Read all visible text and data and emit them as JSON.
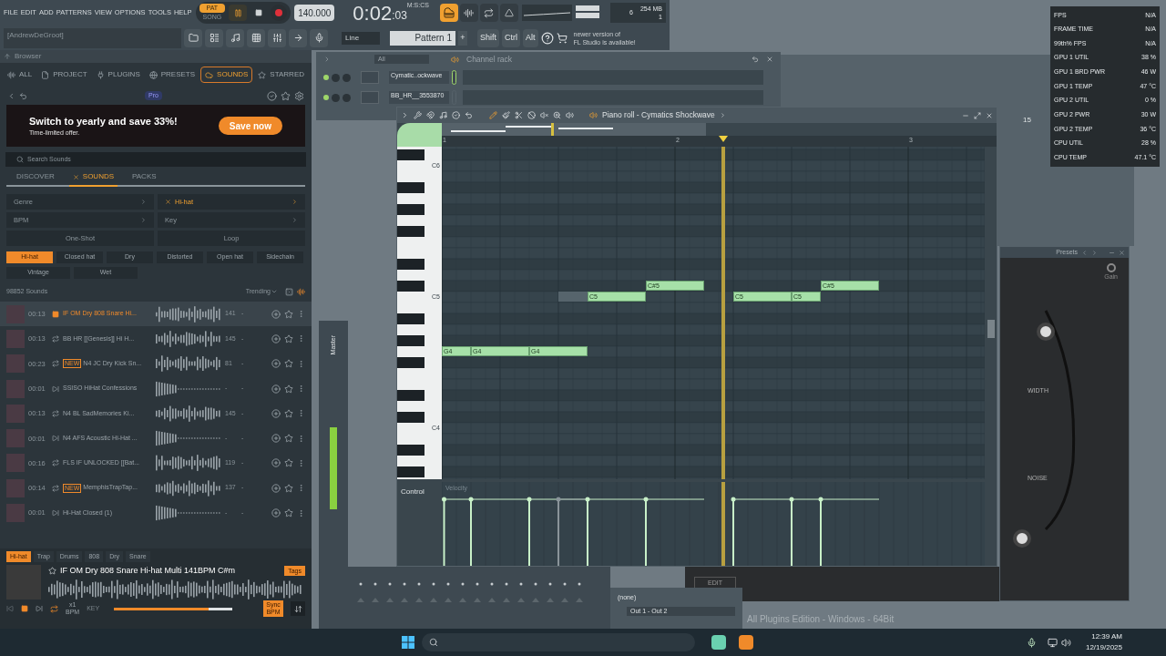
{
  "menu": [
    "FILE",
    "EDIT",
    "ADD",
    "PATTERNS",
    "VIEW",
    "OPTIONS",
    "TOOLS",
    "HELP"
  ],
  "transport": {
    "modes": [
      {
        "label": "PAT",
        "selected": true
      },
      {
        "label": "SONG",
        "selected": false
      }
    ],
    "playing": true,
    "tempo": "140.000",
    "time": "0:02",
    "time_cs": ":03",
    "time_format": "M:S:CS"
  },
  "performance": {
    "cpu": "6",
    "memory": "254 MB",
    "polyphony": "1"
  },
  "hint_bar": "[AndrewDeGroot]",
  "snap": "Line",
  "pattern": "Pattern 1",
  "pattern_add": "+",
  "modifier_keys": [
    "Shift",
    "Ctrl",
    "Alt"
  ],
  "update_notice": [
    "newer version of",
    "FL Studio is available!"
  ],
  "browser": {
    "title": "Browser",
    "tabs": [
      {
        "label": "ALL",
        "selected": false
      },
      {
        "label": "PROJECT",
        "selected": false
      },
      {
        "label": "PLUGINS",
        "selected": false
      },
      {
        "label": "PRESETS",
        "selected": false
      },
      {
        "label": "SOUNDS",
        "selected": true
      },
      {
        "label": "STARRED",
        "selected": false
      }
    ],
    "badge": "Pro",
    "promo": {
      "headline": "Switch to yearly and save 33%!",
      "subline": "Time-limited offer.",
      "button": "Save now"
    },
    "search": {
      "placeholder": "Search Sounds"
    },
    "sections": [
      {
        "label": "DISCOVER",
        "selected": false
      },
      {
        "label": "SOUNDS",
        "selected": true
      },
      {
        "label": "PACKS",
        "selected": false
      }
    ],
    "filters": [
      {
        "label": "Genre",
        "active": false
      },
      {
        "label": "Hi-hat",
        "active": true
      },
      {
        "label": "BPM",
        "active": false
      },
      {
        "label": "Key",
        "active": false
      }
    ],
    "types": [
      "One-Shot",
      "Loop"
    ],
    "tags": [
      {
        "label": "Hi-hat",
        "selected": true
      },
      {
        "label": "Closed hat",
        "selected": false
      },
      {
        "label": "Dry",
        "selected": false
      },
      {
        "label": "Distorted",
        "selected": false
      },
      {
        "label": "Open hat",
        "selected": false
      },
      {
        "label": "Sidechain",
        "selected": false
      },
      {
        "label": "Vintage",
        "selected": false
      },
      {
        "label": "Wet",
        "selected": false
      }
    ],
    "count": "98852 Sounds",
    "sort": "Trending",
    "sounds": [
      {
        "duration": "00:13",
        "kind": "playing",
        "name": "IF OM Dry 808 Snare Hi...",
        "bpm": "141",
        "key": "-",
        "selected": true
      },
      {
        "duration": "00:13",
        "kind": "loop",
        "name": "BB HR [[Genesis]] Hi H...",
        "bpm": "145",
        "key": "-",
        "selected": false
      },
      {
        "duration": "00:23",
        "kind": "loop",
        "badge": "NEW",
        "name": "N4 JC Dry Kick Sn...",
        "bpm": "81",
        "key": "-",
        "selected": false
      },
      {
        "duration": "00:01",
        "kind": "oneshot",
        "name": "SSISO HiHat Confessions",
        "bpm": "-",
        "key": "-",
        "selected": false
      },
      {
        "duration": "00:13",
        "kind": "loop",
        "name": "N4 BL SadMemories Ki...",
        "bpm": "145",
        "key": "-",
        "selected": false
      },
      {
        "duration": "00:01",
        "kind": "oneshot",
        "name": "N4 AFS Acoustic Hi-Hat ...",
        "bpm": "-",
        "key": "-",
        "selected": false
      },
      {
        "duration": "00:16",
        "kind": "loop",
        "name": "FLS IF UNLOCKED [[Bat...",
        "bpm": "119",
        "key": "-",
        "selected": false
      },
      {
        "duration": "00:14",
        "kind": "loop",
        "badge": "NEW",
        "name": "MemphisTrapTap...",
        "bpm": "137",
        "key": "-",
        "selected": false
      },
      {
        "duration": "00:01",
        "kind": "oneshot",
        "name": "Hi-Hat Closed (1)",
        "bpm": "-",
        "key": "-",
        "selected": false
      }
    ],
    "player": {
      "tags": [
        {
          "label": "Hi-hat",
          "selected": true
        },
        {
          "label": "Trap",
          "selected": false
        },
        {
          "label": "Drums",
          "selected": false
        },
        {
          "label": "808",
          "selected": false
        },
        {
          "label": "Dry",
          "selected": false
        },
        {
          "label": "Snare",
          "selected": false
        }
      ],
      "title": "IF OM Dry 808 Snare Hi-hat Multi 141BPM C#m",
      "tags_button": "Tags",
      "speed": "x1",
      "speed_unit": "BPM",
      "key_label": "KEY",
      "loop": true,
      "volume": {
        "level": 0.8
      },
      "sync": {
        "label": "Sync BPM",
        "on": true
      }
    }
  },
  "channel_rack": {
    "filter": "All",
    "title": "Channel rack",
    "channels": [
      {
        "name": "Cymatic..ockwave",
        "selected": true
      },
      {
        "name": "BB_HR__3553870",
        "selected": false
      }
    ]
  },
  "piano_roll": {
    "title": "Piano roll - Cymatics Shockwave",
    "bars": [
      "1",
      "2",
      "3"
    ],
    "key_labels": [
      "C6",
      "C5",
      "C4"
    ],
    "notes": [
      {
        "label": "G4",
        "ghost": false
      },
      {
        "label": "G4",
        "ghost": false
      },
      {
        "label": "G4",
        "ghost": false
      },
      {
        "ghost": true
      },
      {
        "label": "C5",
        "ghost": false
      },
      {
        "label": "C#5",
        "ghost": false
      },
      {
        "label": "C5",
        "ghost": false
      },
      {
        "label": "C5",
        "ghost": false
      },
      {
        "label": "C#5",
        "ghost": false
      }
    ],
    "control": {
      "label": "Control",
      "target": "Velocity"
    }
  },
  "plugin": {
    "title": "Presets",
    "knob": "Gain",
    "dials": [
      "WIDTH",
      "NOISE"
    ],
    "edit": "EDIT"
  },
  "routing": {
    "input": "(none)",
    "output": "Out 1 - Out 2"
  },
  "edition": "All Plugins Edition - Windows - 64Bit",
  "playlist_marker": "15",
  "mixer": {
    "label": "Master"
  },
  "stats": [
    {
      "label": "FPS",
      "value": "N/A"
    },
    {
      "label": "FRAME TIME",
      "value": "N/A"
    },
    {
      "label": "99th% FPS",
      "value": "N/A"
    },
    {
      "label": "GPU 1 UTIL",
      "value": "38 %"
    },
    {
      "label": "GPU 1 BRD PWR",
      "value": "46 W"
    },
    {
      "label": "GPU 1 TEMP",
      "value": "47 °C"
    },
    {
      "label": "GPU 2 UTIL",
      "value": "0 %"
    },
    {
      "label": "GPU 2 PWR",
      "value": "30 W"
    },
    {
      "label": "GPU 2 TEMP",
      "value": "36 °C"
    },
    {
      "label": "CPU UTIL",
      "value": "28 %"
    },
    {
      "label": "CPU TEMP",
      "value": "47.1 °C"
    }
  ],
  "taskbar": {
    "time": "12:39 AM",
    "date": "12/19/2025"
  }
}
